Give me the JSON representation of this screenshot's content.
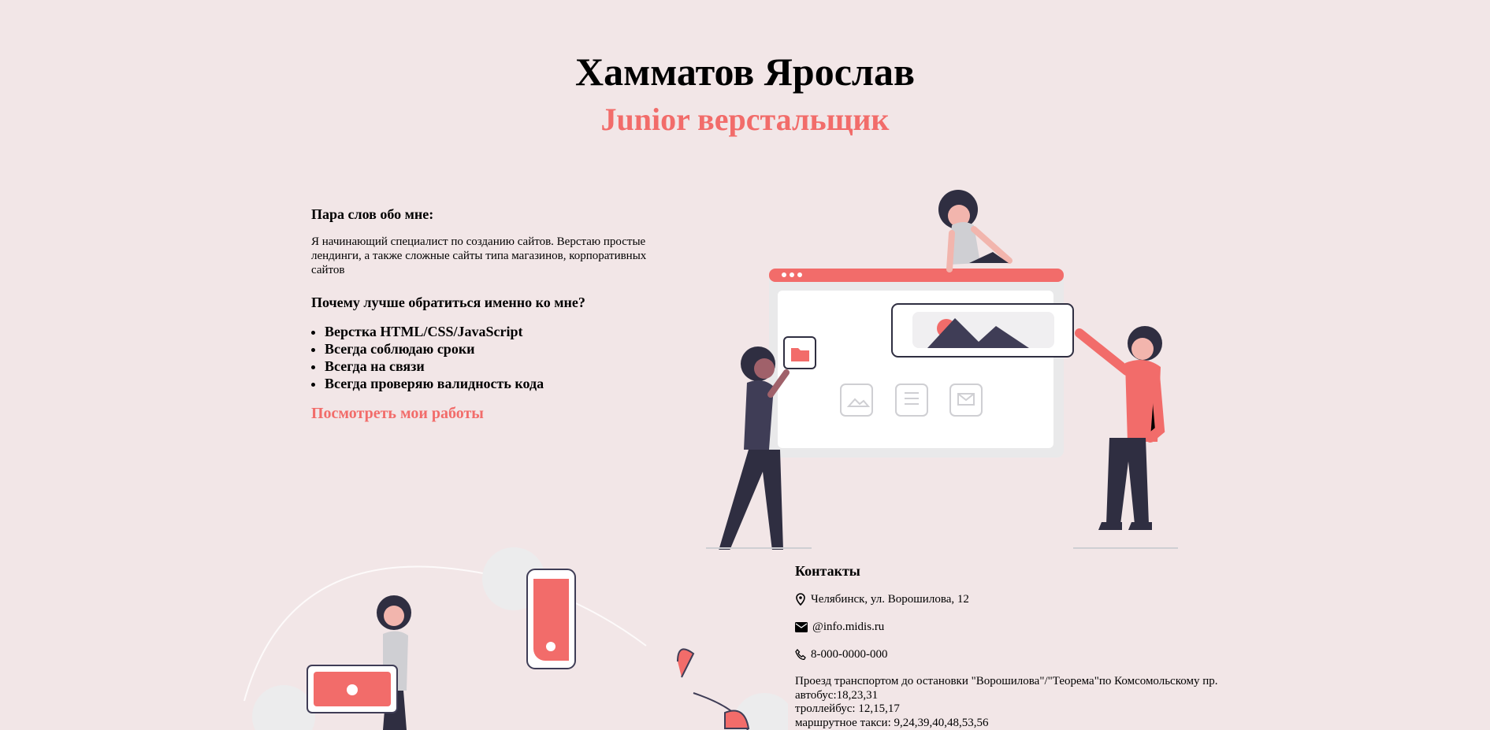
{
  "header": {
    "name": "Хамматов Ярослав",
    "role": "Junior верстальщик"
  },
  "about": {
    "heading": "Пара слов обо мне:",
    "text": "Я начинающий специалист по созданию сайтов. Верстаю простые лендинги, а также сложные сайты типа магазинов, корпоративных сайтов",
    "why_heading": "Почему лучше обратиться именно ко мне?",
    "reasons": [
      "Верстка HTML/CSS/JavaScript",
      "Всегда соблюдаю сроки",
      "Всегда на связи",
      "Всегда проверяю валидность кода"
    ],
    "works_link": "Посмотреть мои работы"
  },
  "contacts": {
    "heading": "Контакты",
    "address": "Челябинск, ул. Ворошилова, 12",
    "email": "@info.midis.ru",
    "phone": "8-000-0000-000",
    "transport_intro": "Проезд транспортом до остановки \"Ворошилова\"/\"Теорема\"по Комсомольскому пр.",
    "bus": "автобус:18,23,31",
    "trolley": "троллейбус: 12,15,17",
    "minibus": "маршрутное такси: 9,24,39,40,48,53,56"
  },
  "icons": {
    "address": "map-pin-icon",
    "email": "envelope-icon",
    "phone": "phone-icon"
  },
  "colors": {
    "accent": "#f26c6a",
    "background": "#f2e6e7",
    "dark": "#2f2e41"
  }
}
